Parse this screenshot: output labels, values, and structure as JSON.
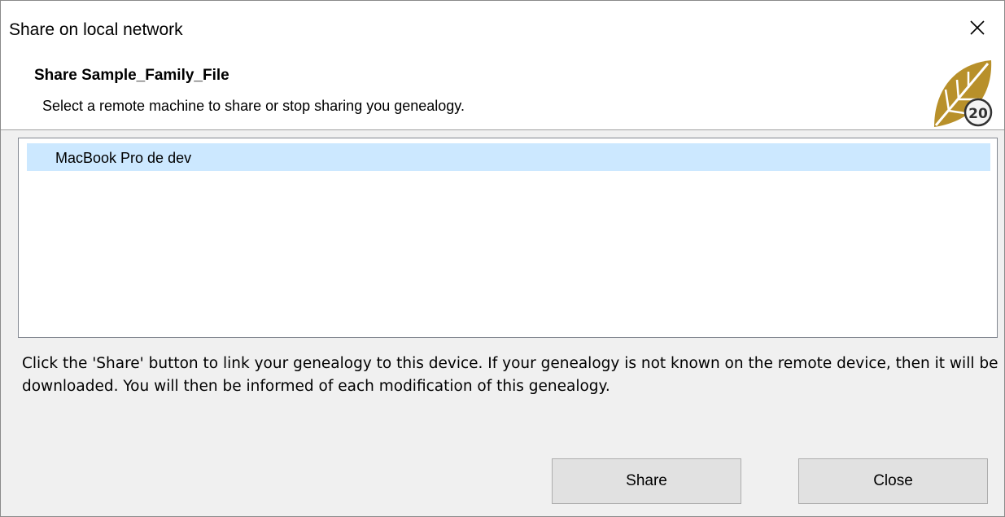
{
  "window": {
    "title": "Share on local network"
  },
  "header": {
    "title": "Share Sample_Family_File",
    "subtitle": "Select a remote machine to share or stop sharing you genealogy.",
    "logo_badge": "20"
  },
  "machines": {
    "items": [
      {
        "label": "MacBook Pro de dev",
        "selected": true
      }
    ]
  },
  "info": {
    "text": "Click the 'Share' button to link your genealogy to this device. If your genealogy is not known on the remote device, then it will be downloaded. You will then be informed of each modification of this genealogy."
  },
  "buttons": {
    "share_label": "Share",
    "close_label": "Close"
  },
  "colors": {
    "selection": "#cce8ff",
    "logo_gold": "#b8902a",
    "button_bg": "#e1e1e1"
  },
  "icons": {
    "close": "close-icon",
    "logo": "leaf-logo-icon"
  }
}
